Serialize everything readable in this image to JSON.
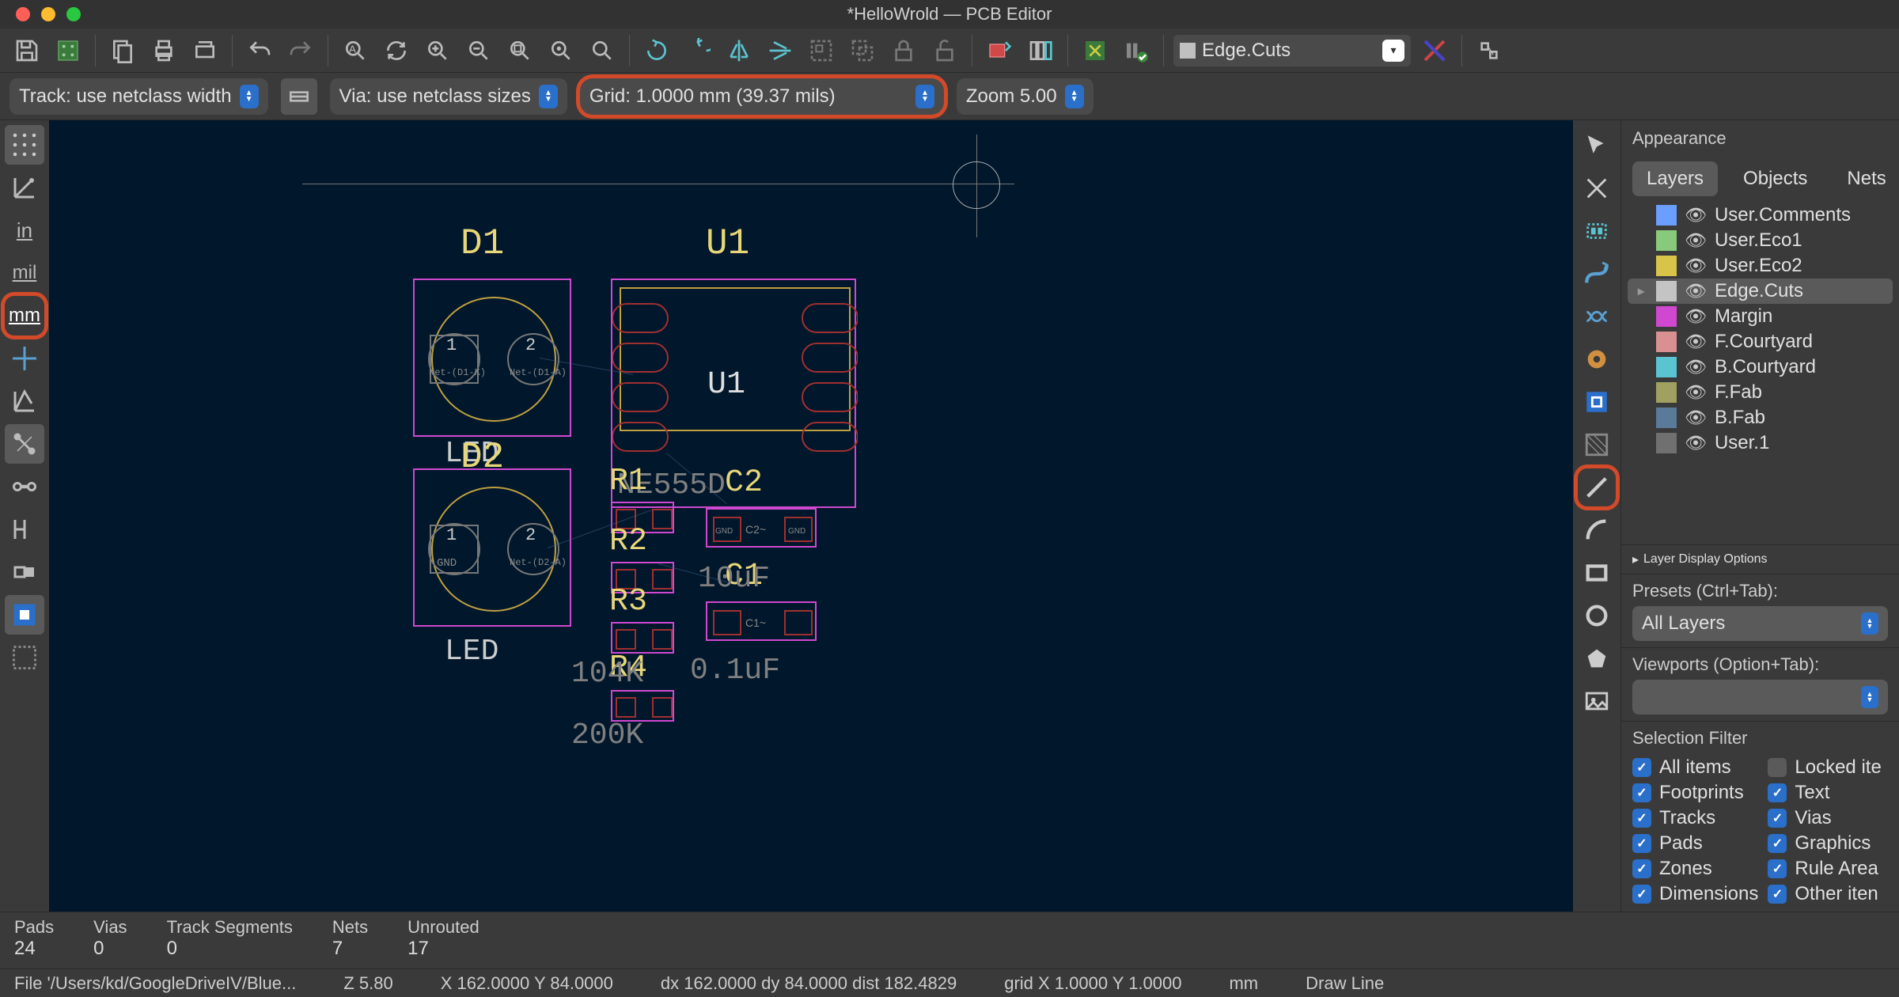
{
  "title": "*HelloWrold — PCB Editor",
  "toolbar2": {
    "track": "Track: use netclass width",
    "via": "Via: use netclass sizes",
    "grid": "Grid: 1.0000 mm (39.37 mils)",
    "zoom": "Zoom 5.00"
  },
  "left_tools_labels": {
    "in": "in",
    "mil": "mil",
    "mm": "mm"
  },
  "layer_select": "Edge.Cuts",
  "appearance": {
    "title": "Appearance",
    "tabs": [
      "Layers",
      "Objects",
      "Nets"
    ],
    "layers": [
      {
        "name": "User.Comments",
        "color": "#6a9eff",
        "active": false
      },
      {
        "name": "User.Eco1",
        "color": "#89c97b",
        "active": false
      },
      {
        "name": "User.Eco2",
        "color": "#d9c44a",
        "active": false
      },
      {
        "name": "Edge.Cuts",
        "color": "#c4c4c4",
        "active": true
      },
      {
        "name": "Margin",
        "color": "#d048d0",
        "active": false
      },
      {
        "name": "F.Courtyard",
        "color": "#d89090",
        "active": false
      },
      {
        "name": "B.Courtyard",
        "color": "#5ac4d0",
        "active": false
      },
      {
        "name": "F.Fab",
        "color": "#a0a060",
        "active": false
      },
      {
        "name": "B.Fab",
        "color": "#5a7a9a",
        "active": false
      },
      {
        "name": "User.1",
        "color": "#707070",
        "active": false
      }
    ],
    "layer_display_options": "Layer Display Options",
    "presets_label": "Presets (Ctrl+Tab):",
    "presets_value": "All Layers",
    "viewports_label": "Viewports (Option+Tab):"
  },
  "selection_filter": {
    "title": "Selection Filter",
    "items_left": [
      "All items",
      "Footprints",
      "Tracks",
      "Pads",
      "Zones",
      "Dimensions"
    ],
    "items_right": [
      "Locked ite",
      "Text",
      "Vias",
      "Graphics",
      "Rule Area",
      "Other iten"
    ]
  },
  "canvas": {
    "refs": {
      "D1": "D1",
      "D2": "D2",
      "U1": "U1",
      "U1_body": "U1",
      "R1": "R1",
      "R2": "R2",
      "R3": "R3",
      "R4": "R4",
      "C1": "C1",
      "C2": "C2"
    },
    "values": {
      "LED1": "LED",
      "LED2": "LED",
      "NE555": "NE555D",
      "R_104K": "104K",
      "R_200K": "200K",
      "C_10uF": "10uF",
      "C_01uF": "0.1uF"
    },
    "pads": {
      "one": "1",
      "two": "2",
      "gnd": "GND",
      "net_d1k": "Net-(D1-K)",
      "net_d1a": "Net-(D1-A)",
      "net_d2a": "Net-(D2-A)"
    }
  },
  "status1": {
    "cols": [
      {
        "label": "Pads",
        "value": "24"
      },
      {
        "label": "Vias",
        "value": "0"
      },
      {
        "label": "Track Segments",
        "value": "0"
      },
      {
        "label": "Nets",
        "value": "7"
      },
      {
        "label": "Unrouted",
        "value": "17"
      }
    ]
  },
  "status2": {
    "file": "File '/Users/kd/GoogleDriveIV/Blue...",
    "z": "Z 5.80",
    "xy": "X 162.0000  Y 84.0000",
    "dxy": "dx 162.0000  dy 84.0000  dist 182.4829",
    "grid": "grid X 1.0000  Y 1.0000",
    "unit": "mm",
    "tool": "Draw Line"
  }
}
